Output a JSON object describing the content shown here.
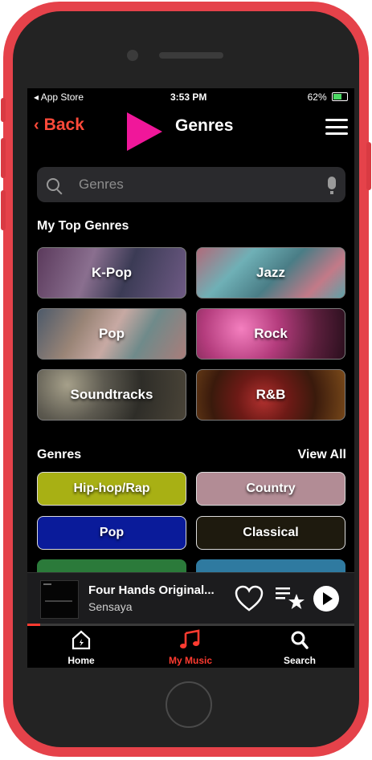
{
  "status_bar": {
    "carrier": "◂ App Store",
    "time": "3:53 PM",
    "battery": "62%"
  },
  "nav": {
    "back_label": "Back",
    "title": "Genres"
  },
  "search": {
    "placeholder": "Genres"
  },
  "top_genres": {
    "heading": "My Top Genres",
    "items": [
      {
        "label": "K-Pop"
      },
      {
        "label": "Jazz"
      },
      {
        "label": "Pop"
      },
      {
        "label": "Rock"
      },
      {
        "label": "Soundtracks"
      },
      {
        "label": "R&B"
      }
    ]
  },
  "genres": {
    "heading": "Genres",
    "view_all": "View All",
    "items": [
      {
        "label": "Hip-hop/Rap",
        "color": "#a8b014"
      },
      {
        "label": "Country",
        "color": "#b28c95"
      },
      {
        "label": "Pop",
        "color": "#0a1b9a"
      },
      {
        "label": "Classical",
        "color": "#1e1a0e"
      },
      {
        "label": "",
        "color": "#2b7a3a"
      },
      {
        "label": "",
        "color": "#2f7aa0"
      }
    ]
  },
  "now_playing": {
    "title": "Four Hands Original...",
    "artist": "Sensaya",
    "progress": 0.04
  },
  "tabs": [
    {
      "label": "Home",
      "icon": "home-icon",
      "active": false
    },
    {
      "label": "My Music",
      "icon": "music-note-icon",
      "active": true
    },
    {
      "label": "Search",
      "icon": "search-icon",
      "active": false
    }
  ],
  "colors": {
    "accent": "#ff3b30",
    "pointer": "#f0179a"
  }
}
